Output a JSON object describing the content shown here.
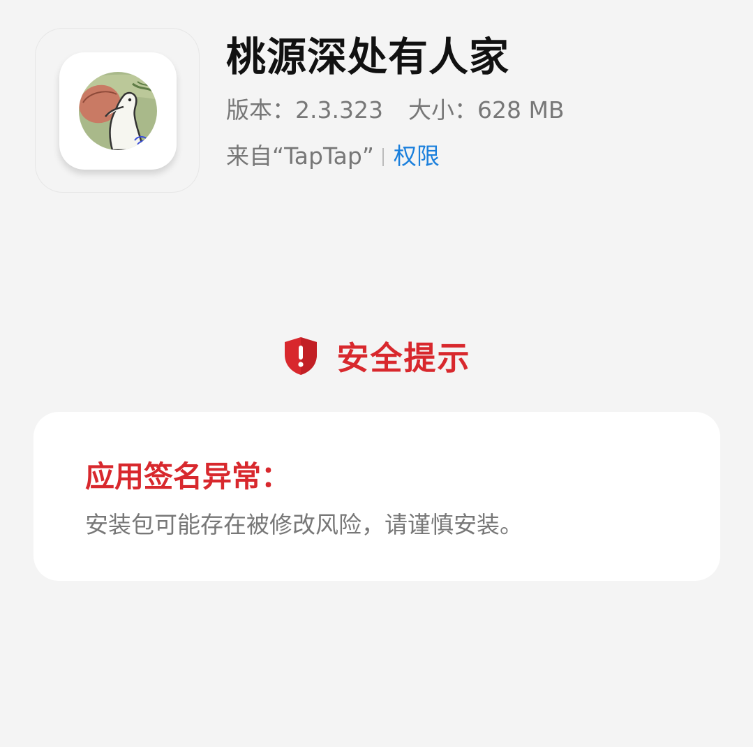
{
  "app": {
    "icon": "app-icon-illustration",
    "name": "桃源深处有人家",
    "version_label": "版本：",
    "version_value": "2.3.323",
    "size_label": "大小：",
    "size_value": "628 MB",
    "source_text": "来自“TapTap”",
    "permission_link": "权限"
  },
  "security": {
    "icon": "shield-alert-icon",
    "title": "安全提示",
    "card_heading": "应用签名异常：",
    "card_message": "安装包可能存在被修改风险，请谨慎安装。"
  },
  "colors": {
    "background": "#f4f4f4",
    "warning_red": "#d8282d",
    "link_blue": "#1a7fdc",
    "secondary_text": "#777777",
    "primary_text": "#111111"
  }
}
